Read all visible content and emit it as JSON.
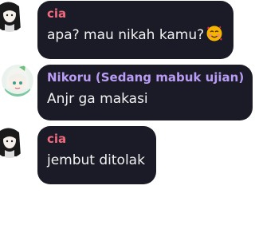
{
  "messages": [
    {
      "author": "cia",
      "author_color": "#f06a7e",
      "text": "apa? mau nikah kamu?",
      "emoji": "smiling-face-with-hearts",
      "avatar": "cia-avatar"
    },
    {
      "author": "Nikoru (Sedang mabuk ujian)",
      "author_color": "#b99cf4",
      "text": "Anjr ga makasi",
      "avatar": "nikoru-avatar"
    },
    {
      "author": "cia",
      "author_color": "#f06a7e",
      "text": "jembut ditolak",
      "avatar": "cia-avatar"
    }
  ],
  "colors": {
    "bubble_background": "#1b1b27",
    "message_text": "#f2f2f2",
    "page_background": "#ffffff"
  }
}
